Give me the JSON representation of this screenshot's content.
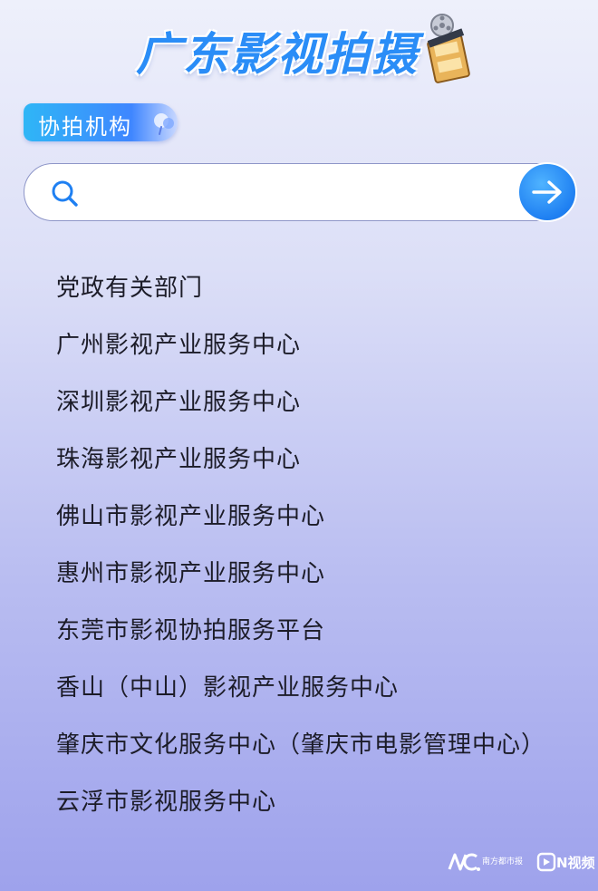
{
  "header": {
    "title": "广东影视拍摄",
    "title_color": "#2a8df7",
    "emblem_icon": "film-reel-clapper-icon"
  },
  "section": {
    "label": "协拍机构",
    "accent_color": "#3f86ff"
  },
  "search": {
    "placeholder": "",
    "value": "",
    "search_icon": "search-icon",
    "submit_icon": "arrow-right-icon",
    "submit_color": "#1f80f2"
  },
  "organizations": [
    {
      "label": "党政有关部门"
    },
    {
      "label": "广州影视产业服务中心"
    },
    {
      "label": "深圳影视产业服务中心"
    },
    {
      "label": "珠海影视产业服务中心"
    },
    {
      "label": "佛山市影视产业服务中心"
    },
    {
      "label": "惠州市影视产业服务中心"
    },
    {
      "label": "东莞市影视协拍服务平台"
    },
    {
      "label": "香山（中山）影视产业服务中心"
    },
    {
      "label": "肇庆市文化服务中心（肇庆市电影管理中心）"
    },
    {
      "label": "云浮市影视服务中心"
    }
  ],
  "watermark": {
    "logo_a_icon": "nandu-logo-icon",
    "logo_a_text": "南方都市报",
    "logo_b_icon": "n-video-logo-icon",
    "logo_b_text": "N视频"
  }
}
